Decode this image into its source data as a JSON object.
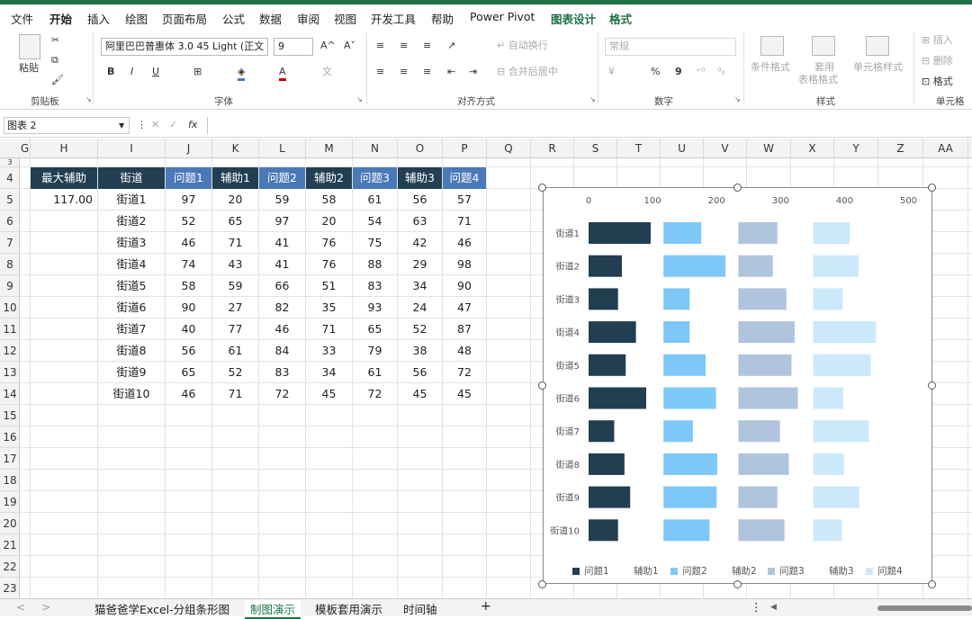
{
  "menu": [
    "文件",
    "开始",
    "插入",
    "绘图",
    "页面布局",
    "公式",
    "数据",
    "审阅",
    "视图",
    "开发工具",
    "帮助",
    "Power Pivot",
    "图表设计",
    "格式"
  ],
  "ribbon": {
    "paste": "粘贴",
    "clipboard": "剪贴板",
    "font_name": "阿里巴巴普惠体 3.0 45 Light (正文",
    "font_size": "9",
    "grow_font": "A^",
    "shrink_font": "A˅",
    "bold": "B",
    "italic": "I",
    "underline": "U",
    "font_color_a": "A",
    "font_group": "字体",
    "wrap_text": "自动换行",
    "merge_center": "合并后居中",
    "alignment": "对齐方式",
    "number_format": "常规",
    "percent": "%",
    "comma": "9",
    "number": "数字",
    "cond_format": "条件格式",
    "table_format_1": "套用",
    "table_format_2": "表格格式",
    "cell_style": "单元格样式",
    "styles": "样式",
    "insert": "插入",
    "delete": "删除",
    "format": "格式",
    "cells": "单元格"
  },
  "formula_bar": {
    "name_box": "图表 2",
    "fx": "fx"
  },
  "columns": [
    "G",
    "H",
    "I",
    "J",
    "K",
    "L",
    "M",
    "N",
    "O",
    "P",
    "Q",
    "R",
    "S",
    "T",
    "U",
    "V",
    "W",
    "X",
    "Y",
    "Z",
    "AA"
  ],
  "rows": [
    "3",
    "4",
    "5",
    "6",
    "7",
    "8",
    "9",
    "10",
    "11",
    "12",
    "13",
    "14",
    "15",
    "16",
    "17",
    "18",
    "19",
    "20",
    "21",
    "22",
    "23"
  ],
  "table": {
    "max_label": "最大辅助",
    "max_value": "117.00",
    "headers": [
      "街道",
      "问题1",
      "辅助1",
      "问题2",
      "辅助2",
      "问题3",
      "辅助3",
      "问题4"
    ],
    "rows": [
      [
        "街道1",
        "97",
        "20",
        "59",
        "58",
        "61",
        "56",
        "57"
      ],
      [
        "街道2",
        "52",
        "65",
        "97",
        "20",
        "54",
        "63",
        "71"
      ],
      [
        "街道3",
        "46",
        "71",
        "41",
        "76",
        "75",
        "42",
        "46"
      ],
      [
        "街道4",
        "74",
        "43",
        "41",
        "76",
        "88",
        "29",
        "98"
      ],
      [
        "街道5",
        "58",
        "59",
        "66",
        "51",
        "83",
        "34",
        "90"
      ],
      [
        "街道6",
        "90",
        "27",
        "82",
        "35",
        "93",
        "24",
        "47"
      ],
      [
        "街道7",
        "40",
        "77",
        "46",
        "71",
        "65",
        "52",
        "87"
      ],
      [
        "街道8",
        "56",
        "61",
        "84",
        "33",
        "79",
        "38",
        "48"
      ],
      [
        "街道9",
        "65",
        "52",
        "83",
        "34",
        "61",
        "56",
        "72"
      ],
      [
        "街道10",
        "46",
        "71",
        "72",
        "45",
        "72",
        "45",
        "45"
      ]
    ]
  },
  "chart_data": {
    "type": "bar",
    "orientation": "horizontal",
    "stacked": true,
    "categories": [
      "街道1",
      "街道2",
      "街道3",
      "街道4",
      "街道5",
      "街道6",
      "街道7",
      "街道8",
      "街道9",
      "街道10"
    ],
    "series": [
      {
        "name": "问题1",
        "values": [
          97,
          52,
          46,
          74,
          58,
          90,
          40,
          56,
          65,
          46
        ],
        "color": "#223f52"
      },
      {
        "name": "辅助1",
        "values": [
          20,
          65,
          71,
          43,
          59,
          27,
          77,
          61,
          52,
          71
        ],
        "color": "none"
      },
      {
        "name": "问题2",
        "values": [
          59,
          97,
          41,
          41,
          66,
          82,
          46,
          84,
          83,
          72
        ],
        "color": "#7ec8f8"
      },
      {
        "name": "辅助2",
        "values": [
          58,
          20,
          76,
          76,
          51,
          35,
          71,
          33,
          34,
          45
        ],
        "color": "none"
      },
      {
        "name": "问题3",
        "values": [
          61,
          54,
          75,
          88,
          83,
          93,
          65,
          79,
          61,
          72
        ],
        "color": "#b0c4de"
      },
      {
        "name": "辅助3",
        "values": [
          56,
          63,
          42,
          29,
          34,
          24,
          52,
          38,
          56,
          45
        ],
        "color": "none"
      },
      {
        "name": "问题4",
        "values": [
          57,
          71,
          46,
          98,
          90,
          47,
          87,
          48,
          72,
          45
        ],
        "color": "#cce9fc"
      }
    ],
    "x_ticks": [
      "0",
      "100",
      "200",
      "300",
      "400",
      "500"
    ],
    "xlim": [
      0,
      500
    ],
    "x_axis_position": "top",
    "grid": false,
    "legend_position": "bottom"
  },
  "sheet_tabs": [
    "猫爸爸学Excel-分组条形图",
    "制图演示",
    "模板套用演示",
    "时间轴"
  ],
  "sheet_nav": {
    "prev": "<",
    "next": ">",
    "add": "+",
    "more": "⋮"
  }
}
